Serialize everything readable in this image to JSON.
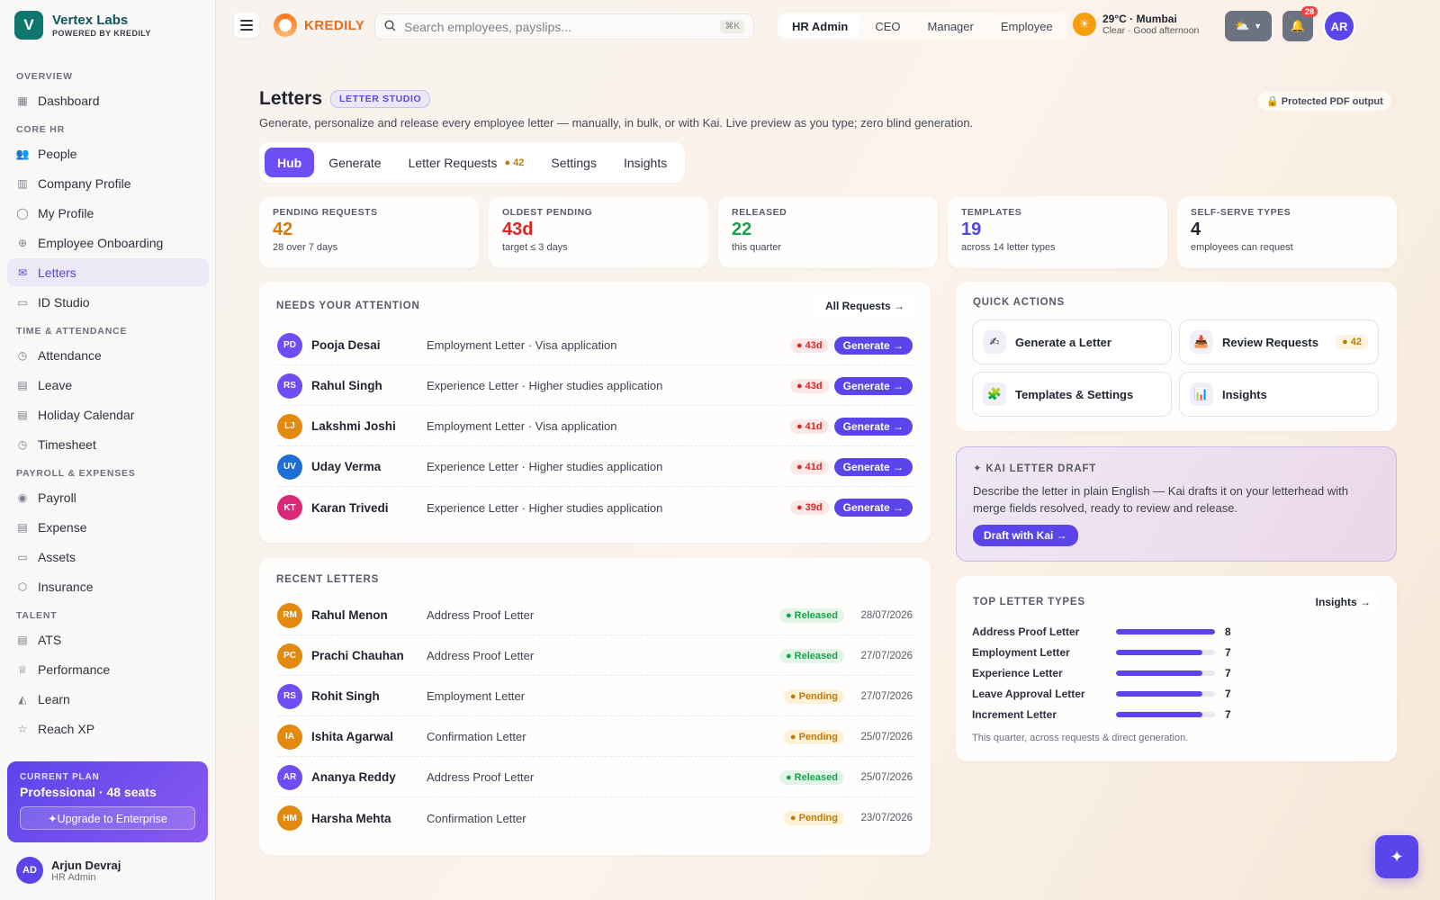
{
  "brand": {
    "name": "Vertex Labs",
    "sub": "POWERED BY KREDILY",
    "logo_letter": "V"
  },
  "sidebar": {
    "sections": [
      {
        "label": "OVERVIEW",
        "items": [
          {
            "label": "Dashboard",
            "icon": "grid-icon"
          }
        ]
      },
      {
        "label": "CORE HR",
        "items": [
          {
            "label": "People",
            "icon": "people-icon"
          },
          {
            "label": "Company Profile",
            "icon": "building-icon"
          },
          {
            "label": "My Profile",
            "icon": "user-icon"
          },
          {
            "label": "Employee Onboarding",
            "icon": "user-plus-icon"
          },
          {
            "label": "Letters",
            "icon": "mail-icon",
            "active": true
          },
          {
            "label": "ID Studio",
            "icon": "id-card-icon"
          }
        ]
      },
      {
        "label": "TIME & ATTENDANCE",
        "items": [
          {
            "label": "Attendance",
            "icon": "clock-icon"
          },
          {
            "label": "Leave",
            "icon": "calendar-icon"
          },
          {
            "label": "Holiday Calendar",
            "icon": "calendar-icon"
          },
          {
            "label": "Timesheet",
            "icon": "clock-icon"
          }
        ]
      },
      {
        "label": "PAYROLL & EXPENSES",
        "items": [
          {
            "label": "Payroll",
            "icon": "coin-icon"
          },
          {
            "label": "Expense",
            "icon": "receipt-icon"
          },
          {
            "label": "Assets",
            "icon": "monitor-icon"
          },
          {
            "label": "Insurance",
            "icon": "shield-icon"
          }
        ]
      },
      {
        "label": "TALENT",
        "items": [
          {
            "label": "ATS",
            "icon": "document-icon"
          },
          {
            "label": "Performance",
            "icon": "trophy-icon"
          },
          {
            "label": "Learn",
            "icon": "graduation-cap-icon"
          },
          {
            "label": "Reach XP",
            "icon": "star-icon"
          }
        ]
      }
    ]
  },
  "plan": {
    "label": "CURRENT PLAN",
    "name": "Professional · 48 seats",
    "upgrade_label": "✦Upgrade to Enterprise"
  },
  "current_user": {
    "initials": "AD",
    "name": "Arjun Devraj",
    "role": "HR Admin"
  },
  "topbar": {
    "product": "KREDILY",
    "search_placeholder": "Search employees, payslips...",
    "search_kbd": "⌘K",
    "roles": [
      {
        "label": "HR Admin",
        "active": true
      },
      {
        "label": "CEO"
      },
      {
        "label": "Manager"
      },
      {
        "label": "Employee"
      }
    ],
    "weather": {
      "line1": "29°C · Mumbai",
      "line2": "Clear · Good afternoon"
    },
    "notifications": "28",
    "avatar": "AR"
  },
  "page": {
    "title": "Letters",
    "badge": "LETTER STUDIO",
    "subtitle": "Generate, personalize and release every employee letter — manually, in bulk, or with Kai. Live preview as you type; zero blind generation.",
    "protected": "🔒 Protected PDF output",
    "tabs": [
      {
        "label": "Hub",
        "active": true
      },
      {
        "label": "Generate"
      },
      {
        "label": "Letter Requests",
        "badge": "● 42"
      },
      {
        "label": "Settings"
      },
      {
        "label": "Insights"
      }
    ]
  },
  "stats": [
    {
      "label": "PENDING REQUESTS",
      "value": "42",
      "sub": "28 over 7 days",
      "color": "#d97706"
    },
    {
      "label": "OLDEST PENDING",
      "value": "43d",
      "sub": "target ≤ 3 days",
      "color": "#dc2626"
    },
    {
      "label": "RELEASED",
      "value": "22",
      "sub": "this quarter",
      "color": "#16a34a"
    },
    {
      "label": "TEMPLATES",
      "value": "19",
      "sub": "across 14 letter types",
      "color": "#4f46e5"
    },
    {
      "label": "SELF-SERVE TYPES",
      "value": "4",
      "sub": "employees can request",
      "color": "#1f2430"
    }
  ],
  "attention": {
    "title": "NEEDS YOUR ATTENTION",
    "all_label": "All Requests →",
    "button_label": "Generate →",
    "rows": [
      {
        "initials": "PD",
        "name": "Pooja Desai",
        "desc": "Employment Letter · Visa application",
        "age": "● 43d",
        "color": "#6d4ef5"
      },
      {
        "initials": "RS",
        "name": "Rahul Singh",
        "desc": "Experience Letter · Higher studies application",
        "age": "● 43d",
        "color": "#6d4ef5"
      },
      {
        "initials": "LJ",
        "name": "Lakshmi Joshi",
        "desc": "Employment Letter · Visa application",
        "age": "● 41d",
        "color": "#e38a0e"
      },
      {
        "initials": "UV",
        "name": "Uday Verma",
        "desc": "Experience Letter · Higher studies application",
        "age": "● 41d",
        "color": "#1d6fd6"
      },
      {
        "initials": "KT",
        "name": "Karan Trivedi",
        "desc": "Experience Letter · Higher studies application",
        "age": "● 39d",
        "color": "#db2777"
      }
    ]
  },
  "recent": {
    "title": "RECENT LETTERS",
    "rows": [
      {
        "initials": "RM",
        "name": "Rahul Menon",
        "desc": "Address Proof Letter",
        "status": "● Released",
        "state": "released",
        "date": "28/07/2026",
        "color": "#e38a0e"
      },
      {
        "initials": "PC",
        "name": "Prachi Chauhan",
        "desc": "Address Proof Letter",
        "status": "● Released",
        "state": "released",
        "date": "27/07/2026",
        "color": "#e38a0e"
      },
      {
        "initials": "RS",
        "name": "Rohit Singh",
        "desc": "Employment Letter",
        "status": "● Pending",
        "state": "pending",
        "date": "27/07/2026",
        "color": "#6d4ef5"
      },
      {
        "initials": "IA",
        "name": "Ishita Agarwal",
        "desc": "Confirmation Letter",
        "status": "● Pending",
        "state": "pending",
        "date": "25/07/2026",
        "color": "#e38a0e"
      },
      {
        "initials": "AR",
        "name": "Ananya Reddy",
        "desc": "Address Proof Letter",
        "status": "● Released",
        "state": "released",
        "date": "25/07/2026",
        "color": "#6d4ef5"
      },
      {
        "initials": "HM",
        "name": "Harsha Mehta",
        "desc": "Confirmation Letter",
        "status": "● Pending",
        "state": "pending",
        "date": "23/07/2026",
        "color": "#e38a0e"
      }
    ]
  },
  "quick_actions": {
    "title": "QUICK ACTIONS",
    "items": [
      {
        "label": "Generate a Letter",
        "icon": "writing-hand-icon",
        "glyph": "✍"
      },
      {
        "label": "Review Requests",
        "icon": "inbox-tray-icon",
        "glyph": "📥",
        "badge": "● 42"
      },
      {
        "label": "Templates & Settings",
        "icon": "puzzle-icon",
        "glyph": "🧩"
      },
      {
        "label": "Insights",
        "icon": "bar-chart-icon",
        "glyph": "📊"
      }
    ]
  },
  "kai": {
    "title": "✦ KAI LETTER DRAFT",
    "desc": "Describe the letter in plain English — Kai drafts it on your letterhead with merge fields resolved, ready to review and release.",
    "button": "Draft with Kai →"
  },
  "top_types": {
    "title": "TOP LETTER TYPES",
    "link": "Insights →",
    "footer": "This quarter, across requests & direct generation.",
    "max": 8,
    "items": [
      {
        "label": "Address Proof Letter",
        "value": 8
      },
      {
        "label": "Employment Letter",
        "value": 7
      },
      {
        "label": "Experience Letter",
        "value": 7
      },
      {
        "label": "Leave Approval Letter",
        "value": 7
      },
      {
        "label": "Increment Letter",
        "value": 7
      }
    ]
  }
}
